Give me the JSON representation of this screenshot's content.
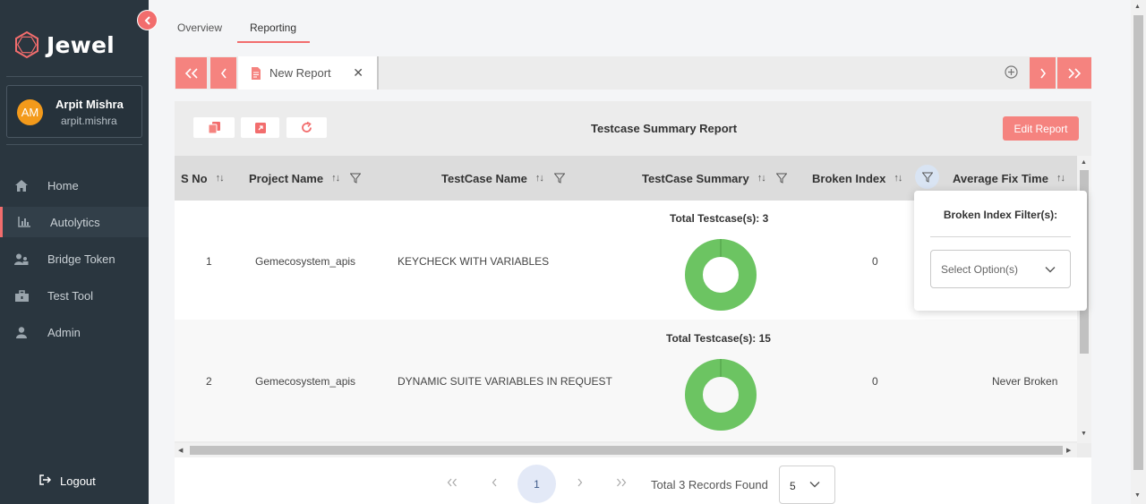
{
  "app": {
    "name": "Jewel"
  },
  "user": {
    "initials": "AM",
    "name": "Arpit Mishra",
    "handle": "arpit.mishra"
  },
  "sidebar": {
    "items": [
      {
        "label": "Home",
        "icon": "home-icon"
      },
      {
        "label": "Autolytics",
        "icon": "chart-icon",
        "active": true
      },
      {
        "label": "Bridge Token",
        "icon": "users-icon"
      },
      {
        "label": "Test Tool",
        "icon": "toolbox-icon"
      },
      {
        "label": "Admin",
        "icon": "user-icon"
      }
    ],
    "logout_label": "Logout"
  },
  "top_tabs": [
    {
      "label": "Overview"
    },
    {
      "label": "Reporting",
      "active": true
    }
  ],
  "report_tab": {
    "label": "New Report",
    "close": "✕"
  },
  "nav_buttons": {
    "first": "<<",
    "prev": "<",
    "next": ">",
    "last": ">>"
  },
  "report": {
    "title": "Testcase Summary Report",
    "edit_label": "Edit Report"
  },
  "table": {
    "columns": [
      "S No",
      "Project Name",
      "TestCase Name",
      "TestCase Summary",
      "Broken Index",
      "Average Fix Time"
    ],
    "rows": [
      {
        "sno": "1",
        "project": "Gemecosystem_apis",
        "testcase": "KEYCHECK WITH VARIABLES",
        "summary_label": "Total Testcase(s): 3",
        "broken_index": "0",
        "avg_fix": "",
        "pass_fraction": 1.0
      },
      {
        "sno": "2",
        "project": "Gemecosystem_apis",
        "testcase": "DYNAMIC SUITE VARIABLES IN REQUEST",
        "summary_label": "Total Testcase(s): 15",
        "broken_index": "0",
        "avg_fix": "Never Broken",
        "pass_fraction": 1.0
      }
    ]
  },
  "filter_popup": {
    "title": "Broken Index Filter(s):",
    "placeholder": "Select Option(s)"
  },
  "pagination": {
    "current_page": "1",
    "records_text": "Total 3 Records Found",
    "page_size": "5"
  },
  "colors": {
    "accent": "#f5837f",
    "sidebar_bg": "#2a363f",
    "donut_pass": "#6cc462"
  }
}
